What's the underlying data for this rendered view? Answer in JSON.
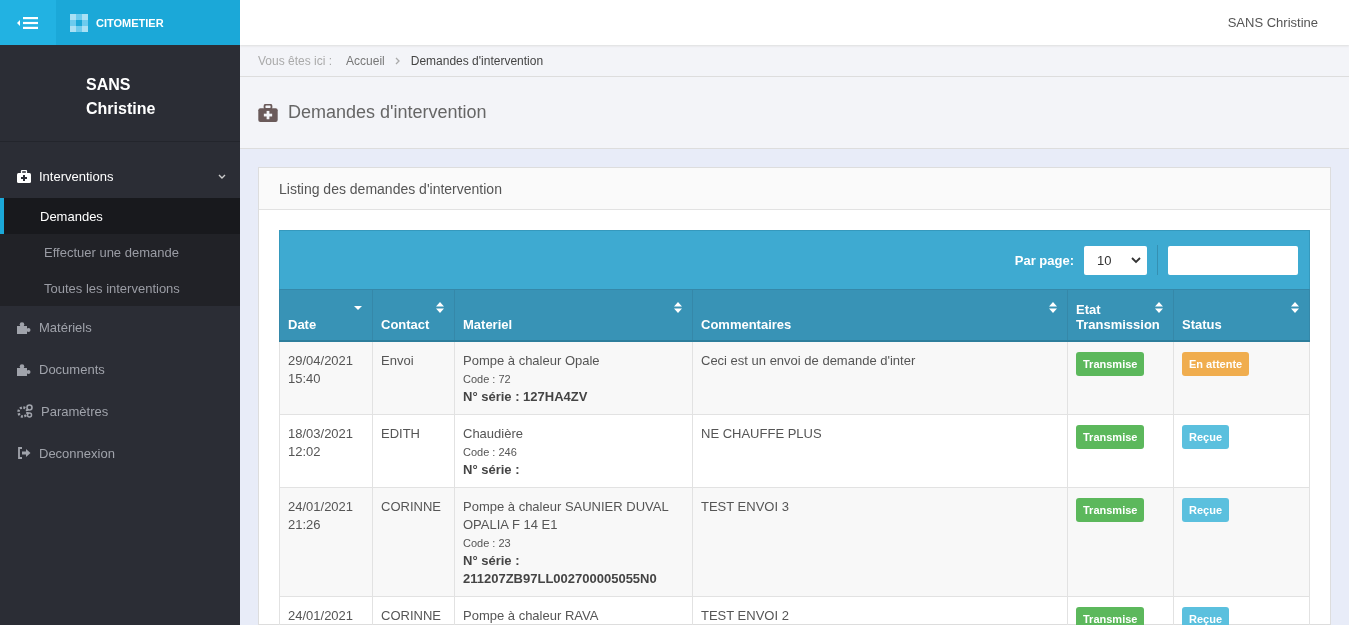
{
  "brand": {
    "name": "CITOMETIER"
  },
  "topbar": {
    "user": "SANS Christine"
  },
  "sidebar": {
    "user_name": "SANS Christine",
    "items": [
      {
        "label": "Interventions",
        "expanded": true,
        "children": [
          {
            "label": "Demandes",
            "selected": true
          },
          {
            "label": "Effectuer une demande",
            "selected": false
          },
          {
            "label": "Toutes les interventions",
            "selected": false
          }
        ]
      },
      {
        "label": "Matériels",
        "expanded": false
      },
      {
        "label": "Documents",
        "expanded": false
      },
      {
        "label": "Paramètres",
        "expanded": false
      },
      {
        "label": "Deconnexion",
        "expanded": false
      }
    ]
  },
  "breadcrumb": {
    "prefix": "Vous êtes ici :",
    "items": [
      "Accueil",
      "Demandes d'intervention"
    ]
  },
  "page_title": "Demandes d'intervention",
  "panel": {
    "title": "Listing des demandes d'intervention",
    "per_page_label": "Par page:",
    "per_page": "10",
    "table": {
      "columns": [
        {
          "label": "Date",
          "sorted": true
        },
        {
          "label": "Contact",
          "sorted": false
        },
        {
          "label": "Materiel",
          "sorted": false
        },
        {
          "label": "Commentaires",
          "sorted": false
        },
        {
          "label": "Etat Transmission",
          "sorted": false
        },
        {
          "label": "Status",
          "sorted": false
        }
      ],
      "rows": [
        {
          "date": "29/04/2021 15:40",
          "contact": "Envoi",
          "material": "Pompe à chaleur Opale",
          "code": "Code : 72",
          "serial": "N° série : 127HA4ZV",
          "comment": "Ceci est un envoi de demande d'inter",
          "transmission": {
            "text": "Transmise",
            "color": "#5cb85c"
          },
          "status": {
            "text": "En attente",
            "color": "#f0ad4e"
          }
        },
        {
          "date": "18/03/2021 12:02",
          "contact": "EDITH",
          "material": "Chaudière",
          "code": "Code : 246",
          "serial": "N° série :",
          "comment": "NE CHAUFFE PLUS",
          "transmission": {
            "text": "Transmise",
            "color": "#5cb85c"
          },
          "status": {
            "text": "Reçue",
            "color": "#5bc0de"
          }
        },
        {
          "date": "24/01/2021 21:26",
          "contact": "CORINNE",
          "material": "Pompe à chaleur SAUNIER DUVAL OPALIA F 14 E1",
          "code": "Code : 23",
          "serial": "N° série : 211207ZB97LL002700005055N0",
          "comment": "TEST ENVOI 3",
          "transmission": {
            "text": "Transmise",
            "color": "#5cb85c"
          },
          "status": {
            "text": "Reçue",
            "color": "#5bc0de"
          }
        },
        {
          "date": "24/01/2021",
          "contact": "CORINNE",
          "material": "Pompe à chaleur RAVA",
          "comment": "TEST ENVOI 2",
          "transmission": {
            "text": "Transmise",
            "color": "#5cb85c"
          },
          "status": {
            "text": "Reçue",
            "color": "#5bc0de"
          }
        }
      ]
    }
  }
}
